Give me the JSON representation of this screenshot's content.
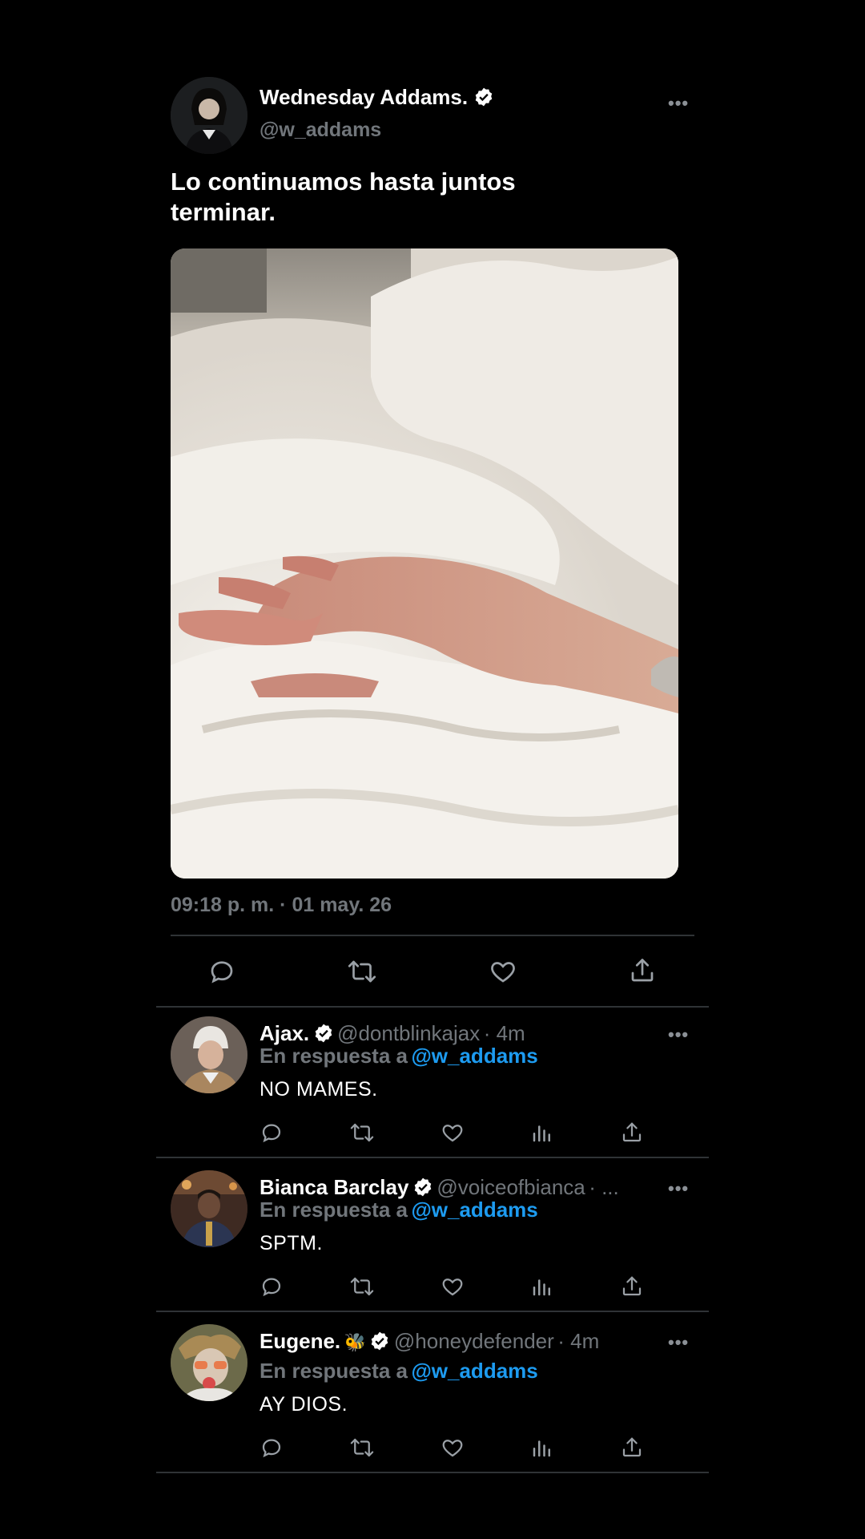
{
  "tweet": {
    "author_name": "Wednesday Addams.",
    "author_handle": "@w_addams",
    "text": "Lo continuamos hasta juntos terminar.",
    "timestamp": "09:18 p. m. · 01 may. 26",
    "media_description": "hands-on-white-sheets"
  },
  "replies": [
    {
      "name": "Ajax.",
      "handle": "@dontblinkajax",
      "time": "· 4m",
      "context_prefix": "En respuesta a",
      "context_mention": "@w_addams",
      "text": "NO MAMES."
    },
    {
      "name": "Bianca Barclay",
      "handle": "@voiceofbianca",
      "time": "· ...",
      "context_prefix": "En respuesta a",
      "context_mention": "@w_addams",
      "text": "SPTM."
    },
    {
      "name": "Eugene.",
      "emoji": "🐝",
      "handle": "@honeydefender",
      "time": "· 4m",
      "context_prefix": "En respuesta a",
      "context_mention": "@w_addams",
      "text": "AY DIOS."
    }
  ],
  "more_glyph": "•••",
  "colors": {
    "background": "#000000",
    "accent": "#1d9bf0",
    "muted": "#71767b",
    "divider": "#2f3336"
  },
  "icons": [
    "reply-icon",
    "retweet-icon",
    "like-icon",
    "share-icon",
    "views-icon",
    "verified-icon",
    "more-icon"
  ]
}
